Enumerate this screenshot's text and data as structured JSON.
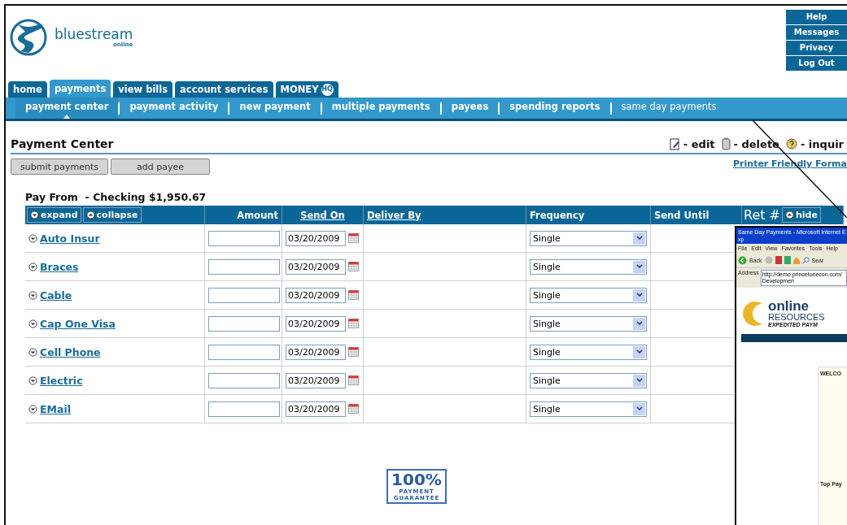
{
  "logo": {
    "name": "bluestream",
    "sub": "online"
  },
  "utility_links": [
    "Help",
    "Messages",
    "Privacy",
    "Log Out"
  ],
  "tabs": [
    {
      "label": "home",
      "selected": false
    },
    {
      "label": "payments",
      "selected": true
    },
    {
      "label": "view bills",
      "selected": false
    },
    {
      "label": "account services",
      "selected": false
    },
    {
      "label": "MONEY",
      "badge": "HQ",
      "selected": false
    }
  ],
  "subnav": [
    {
      "label": "payment center",
      "selected": true,
      "kind": "standard"
    },
    {
      "label": "payment activity",
      "selected": false,
      "kind": "standard"
    },
    {
      "label": "new payment",
      "selected": false,
      "kind": "standard"
    },
    {
      "label": "multiple payments",
      "selected": false,
      "kind": "standard"
    },
    {
      "label": "payees",
      "selected": false,
      "kind": "standard"
    },
    {
      "label": "spending reports",
      "selected": false,
      "kind": "standard"
    },
    {
      "label": "same day payments",
      "selected": false,
      "kind": "plain"
    }
  ],
  "page_title": "Payment Center",
  "legend": [
    {
      "kind": "edit",
      "label": "- edit"
    },
    {
      "kind": "delete",
      "label": "- delete"
    },
    {
      "kind": "inquire",
      "label": "- inquir"
    }
  ],
  "printer_link": "Printer Friendly Forma",
  "buttons": [
    "submit payments",
    "add payee"
  ],
  "pay_from": "Pay From  - Checking $1,950.67",
  "table": {
    "controls": [
      {
        "kind": "expand",
        "label": "expand"
      },
      {
        "kind": "collapse",
        "label": "collapse"
      }
    ],
    "columns": [
      {
        "label": "Amount",
        "link": false
      },
      {
        "label": "Send On",
        "link": true
      },
      {
        "label": "Deliver By",
        "link": true
      },
      {
        "label": "Frequency",
        "link": false
      },
      {
        "label": "Send Until",
        "link": false
      },
      {
        "label": "Ret #",
        "link": false
      }
    ],
    "hide": "hide",
    "rows": [
      {
        "payee": "Auto Insur",
        "send_on": "03/20/2009",
        "frequency": "Single"
      },
      {
        "payee": "Braces",
        "send_on": "03/20/2009",
        "frequency": "Single"
      },
      {
        "payee": "Cable",
        "send_on": "03/20/2009",
        "frequency": "Single"
      },
      {
        "payee": "Cap One Visa",
        "send_on": "03/20/2009",
        "frequency": "Single"
      },
      {
        "payee": "Cell Phone",
        "send_on": "03/20/2009",
        "frequency": "Single"
      },
      {
        "payee": "Electric",
        "send_on": "03/20/2009",
        "frequency": "Single"
      },
      {
        "payee": "EMail",
        "send_on": "03/20/2009",
        "frequency": "Single"
      }
    ]
  },
  "guarantee": {
    "headline": "100%",
    "line_1": "PAYMENT",
    "line_2": "GUARANTEE"
  },
  "inset_window": {
    "title": "Same Day Payments - Microsoft Internet Exp",
    "menu": [
      "File",
      "Edit",
      "View",
      "Favorites",
      "Tools",
      "Help"
    ],
    "back": "Back",
    "search": "Sear",
    "address_label": "Address",
    "address": "http://demo.princetonecon.com/Developmen",
    "brand": [
      "online",
      "RESOURCES",
      "EXPEDITED PAYM"
    ],
    "welcome": "WELCO",
    "footer": "Top Pay"
  }
}
